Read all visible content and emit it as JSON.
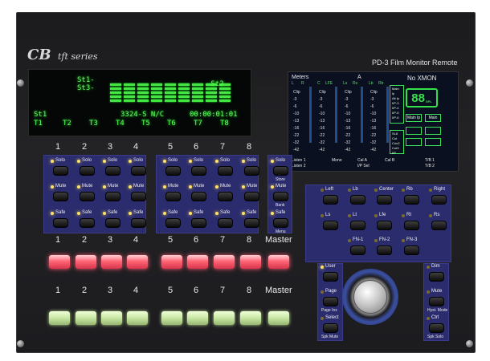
{
  "brand": {
    "logo": "CB",
    "series": "tft series",
    "product": "PD-3 Film Monitor Remote"
  },
  "vfd": {
    "st1_label": "St1-",
    "st3_label": "St3-",
    "st2_label": "-St2",
    "row_st1": "St1",
    "status": "3324-S N/C",
    "timecode": "00:00:01:01",
    "tracks": [
      "T1",
      "T2",
      "T3",
      "T4",
      "T5",
      "T6",
      "T7",
      "T8"
    ]
  },
  "tft": {
    "meters_label": "Meters",
    "a_label": "A",
    "no_xmon": "No XMON",
    "col_headers": [
      "Clip",
      "Clip",
      "Clip",
      "Clip"
    ],
    "scale": [
      "-3",
      "-6",
      "-10",
      "-13",
      "-16",
      "-22",
      "-32",
      "-42"
    ],
    "ch_top": [
      "L",
      "R",
      "C",
      "LFE",
      "Ls",
      "Rs",
      "Lb",
      "Rb"
    ],
    "spl_value": "88",
    "spl_unit": "SPL",
    "main_list": [
      "Main lp",
      "Alt lp",
      "I/P-3",
      "I/P-4",
      "I/P-5",
      "I/P-6"
    ],
    "btn_main_lp": "Main lp",
    "btn_main": "Main",
    "side_list": [
      "SL8",
      "Cut",
      "Coo2",
      "Cut3",
      "I/P"
    ],
    "bottom": [
      "Listen 1",
      "Mono",
      "Cal A",
      "Cal B",
      "T/B 1"
    ],
    "bottom2": [
      "Listen 2",
      "I/P Sel",
      "T/B 2"
    ]
  },
  "channels_top": [
    "1",
    "2",
    "3",
    "4",
    "5",
    "6",
    "7",
    "8"
  ],
  "channel_buttons": {
    "solo": "Solo",
    "mute": "Mute",
    "safe": "Safe"
  },
  "master_column": {
    "solo": "Solo",
    "store": "Store",
    "mute": "Mute",
    "bank": "Bank",
    "safe": "Safe",
    "menu": "Menu"
  },
  "channels_mid": [
    "1",
    "2",
    "3",
    "4",
    "5",
    "6",
    "7",
    "8"
  ],
  "master_label_1": "Master",
  "channels_bottom": [
    "1",
    "2",
    "3",
    "4",
    "5",
    "6",
    "7",
    "8"
  ],
  "master_label_2": "Master",
  "monitor_buttons": {
    "row1": [
      "Left",
      "Lb",
      "Center",
      "Rb",
      "Right"
    ],
    "row2": [
      "Ls",
      "Lt",
      "Lfe",
      "Rt",
      "Rs"
    ],
    "row3": [
      "FN-1",
      "FN-2",
      "FN-3"
    ]
  },
  "lower_buttons": {
    "user": "User",
    "page": "Page",
    "page_sub": "Page Ins",
    "select": "Select",
    "select_sub": "Spk Mute",
    "dim": "Dim",
    "mute": "Mute",
    "mute_sub": "Hyst. Mode",
    "ctrl": "Ctrl",
    "ctrl_sub": "Spk Solo"
  }
}
